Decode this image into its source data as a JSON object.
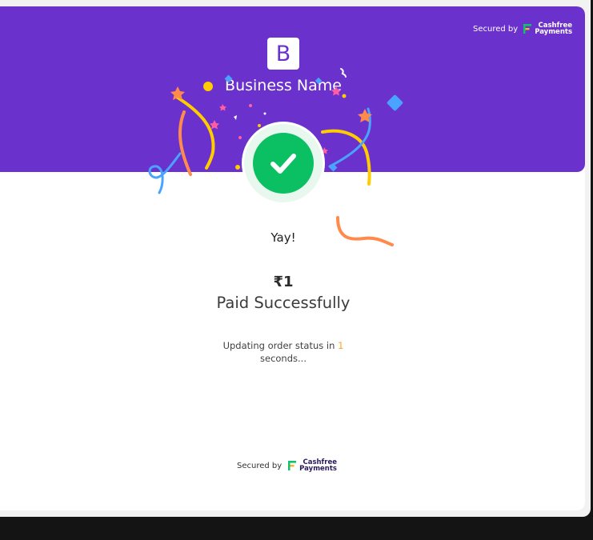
{
  "header": {
    "secured_by_label": "Secured by",
    "brand_line1": "Cashfree",
    "brand_line2": "Payments",
    "business_initial": "B",
    "business_name": "Business Name"
  },
  "status": {
    "yay_text": "Yay!",
    "amount": "₹1",
    "result_text": "Paid Successfully",
    "updating_prefix": "Updating order status in",
    "countdown_value": "1",
    "updating_suffix": "seconds..."
  },
  "footer": {
    "secured_by_label": "Secured by",
    "brand_line1": "Cashfree",
    "brand_line2": "Payments"
  },
  "colors": {
    "header_purple": "#6a31cd",
    "success_green": "#0bc062",
    "countdown_orange": "#f5a623",
    "brand_green": "#11c16d",
    "brand_orange": "#ffb11b"
  },
  "icons": [
    "cashfree-logo-icon",
    "checkmark-icon"
  ]
}
